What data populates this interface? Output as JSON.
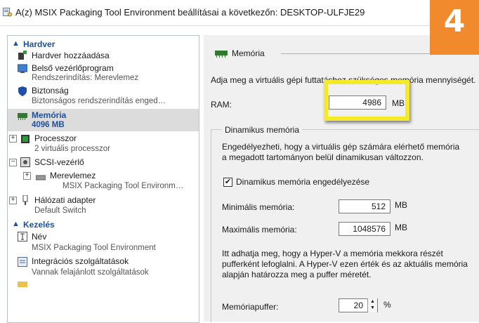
{
  "window": {
    "title": "A(z) MSIX Packaging Tool Environment beállításai a következőn: DESKTOP-ULFJE29"
  },
  "badge": {
    "text": "4"
  },
  "sidebar": {
    "hardware_header": "Hardver",
    "management_header": "Kezelés",
    "hardware_items": [
      {
        "label": "Hardver hozzáadása",
        "sub": ""
      },
      {
        "label": "Belső vezérlőprogram",
        "sub": "Rendszerindítás: Merevlemez"
      },
      {
        "label": "Biztonság",
        "sub": "Biztonságos rendszerindítás enged…"
      },
      {
        "label": "Memória",
        "sub": "4096 MB"
      },
      {
        "label": "Processzor",
        "sub": "2 virtuális processzor"
      },
      {
        "label": "SCSI-vezérlő",
        "sub": ""
      },
      {
        "label": "Merevlemez",
        "sub": "MSIX Packaging Tool Environm…"
      },
      {
        "label": "Hálózati adapter",
        "sub": "Default Switch"
      }
    ],
    "management_items": [
      {
        "label": "Név",
        "sub": "MSIX Packaging Tool Environment"
      },
      {
        "label": "Integrációs szolgáltatások",
        "sub": "Vannak felajánlott szolgáltatások"
      }
    ]
  },
  "memory": {
    "section_title": "Memória",
    "intro": "Adja meg a virtuális gépi futtatáshoz szükséges memória mennyiségét.",
    "ram_label": "RAM:",
    "ram_value": "4986",
    "ram_unit": "MB",
    "dynamic_title": "Dinamikus memória",
    "dynamic_desc_1": "Engedélyezheti, hogy a virtuális gép számára elérhető memória",
    "dynamic_desc_2": "a megadott tartományon belül dinamikusan változzon.",
    "dynamic_enabled": true,
    "checkbox_label": "Dinamikus memória engedélyezése",
    "min_label": "Minimális memória:",
    "min_value": "512",
    "min_unit": "MB",
    "max_label": "Maximális memória:",
    "max_value": "1048576",
    "max_unit": "MB",
    "buffer_desc_1": "Itt adhatja meg, hogy a Hyper-V a memória mekkora részét",
    "buffer_desc_2": "pufferként lefoglalni. A Hyper-V ezen érték és az aktuális memória",
    "buffer_desc_3": "alapján határozza meg a puffer méretét.",
    "buffer_label": "Memóriapuffer:",
    "buffer_value": "20",
    "buffer_unit": "%"
  }
}
